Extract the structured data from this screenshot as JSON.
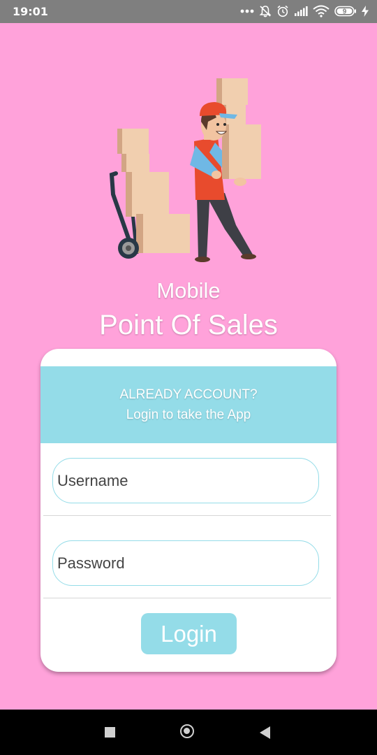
{
  "status_bar": {
    "time": "19:01",
    "battery_level": "9"
  },
  "app": {
    "subtitle": "Mobile",
    "title": "Point Of Sales"
  },
  "login_card": {
    "header_line1": "ALREADY ACCOUNT?",
    "header_line2": "Login to take the App",
    "username_placeholder": "Username",
    "password_placeholder": "Password",
    "login_label": "Login"
  },
  "colors": {
    "background": "#ffa2da",
    "accent": "#94dce8",
    "card": "#ffffff"
  },
  "icons": [
    "more-icon",
    "bell-off-icon",
    "alarm-icon",
    "signal-icon",
    "wifi-icon",
    "battery-icon",
    "charging-icon",
    "nav-recents-icon",
    "nav-home-icon",
    "nav-back-icon"
  ]
}
